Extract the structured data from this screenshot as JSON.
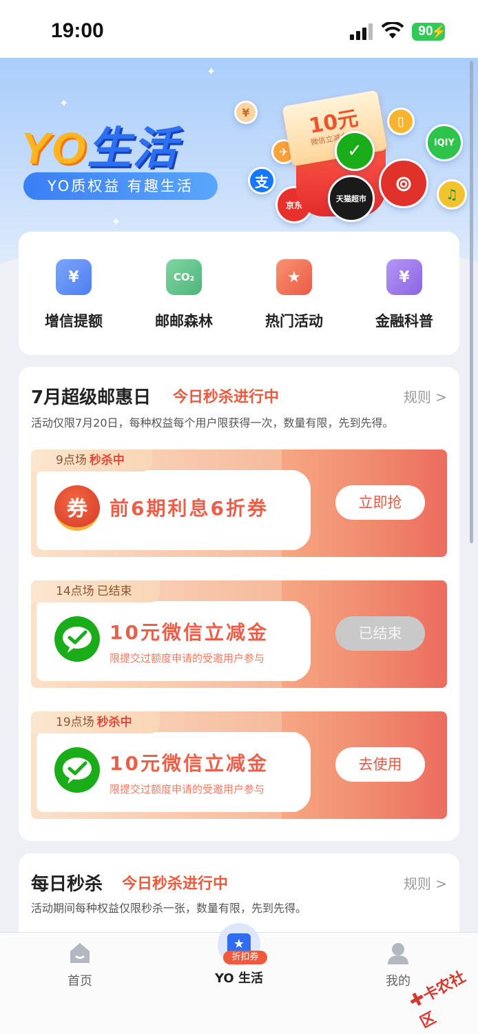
{
  "status_bar": {
    "time": "19:00",
    "battery": "90"
  },
  "banner": {
    "title_yo": "YO",
    "title_life": "生活",
    "subtitle": "YO质权益 有趣生活",
    "coupon_amount": "10元",
    "coupon_text": "微信立减金",
    "icon_labels": {
      "alipay": "支",
      "jd": "京东",
      "tmall": "天猫超市",
      "iqiyi": "iQIY"
    }
  },
  "quick_nav": [
    {
      "label": "增信提额",
      "icon": "wallet-icon",
      "color": "#5d8cf2"
    },
    {
      "label": "邮邮森林",
      "icon": "co2-leaf-icon",
      "color": "#5fbf86"
    },
    {
      "label": "热门活动",
      "icon": "bookmark-star-icon",
      "color": "#f06d4f"
    },
    {
      "label": "金融科普",
      "icon": "finance-doc-icon",
      "color": "#9b72e8"
    }
  ],
  "flash_sale": {
    "title": "7月超级邮惠日",
    "live_status": "今日秒杀进行中",
    "rules": "规则 >",
    "description": "活动仅限7月20日，每种权益每个用户限获得一次，数量有限，先到先得。",
    "deals": [
      {
        "session": "9点场",
        "state": "秒杀中",
        "icon": "coupon-quan-icon",
        "icon_text": "券",
        "name": "前6期利息6折券",
        "note": "",
        "button": "立即抢",
        "disabled": false
      },
      {
        "session": "14点场",
        "state": "已结束",
        "icon": "wechat-icon",
        "icon_text": "",
        "name": "10元微信立减金",
        "note": "限提交过额度申请的受邀用户参与",
        "button": "已结束",
        "disabled": true
      },
      {
        "session": "19点场",
        "state": "秒杀中",
        "icon": "wechat-icon",
        "icon_text": "",
        "name": "10元微信立减金",
        "note": "限提交过额度申请的受邀用户参与",
        "button": "去使用",
        "disabled": false
      }
    ]
  },
  "daily_sale": {
    "title": "每日秒杀",
    "live_status": "今日秒杀进行中",
    "rules": "规则 >",
    "description": "活动期间每种权益仅限秒杀一张，数量有限，先到先得。"
  },
  "tabbar": {
    "home": "首页",
    "center": "YO 生活",
    "center_badge": "折扣券",
    "mine": "我的"
  },
  "watermark": "卡农社区",
  "colors": {
    "accent_red": "#ea5a3d",
    "brand_blue": "#2f6cf0",
    "wechat_green": "#1aad19"
  }
}
